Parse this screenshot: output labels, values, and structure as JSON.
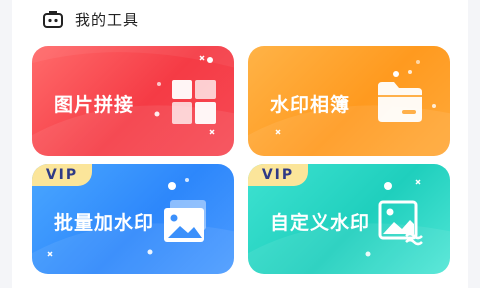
{
  "header": {
    "title": "我的工具",
    "icon": "toolbox-icon"
  },
  "cards": [
    {
      "label": "图片拼接",
      "icon": "grid-collage-icon",
      "vip": false
    },
    {
      "label": "水印相簿",
      "icon": "folder-icon",
      "vip": false
    },
    {
      "label": "批量加水印",
      "icon": "stacked-images-icon",
      "vip": true,
      "badge": "VIP"
    },
    {
      "label": "自定义水印",
      "icon": "image-edit-icon",
      "vip": true,
      "badge": "VIP"
    }
  ],
  "colors": {
    "red": "#f53b45",
    "orange": "#ff9a1f",
    "blue": "#2d87fb",
    "teal": "#1fcfbd",
    "vip_bg": "#fbe59a",
    "vip_text": "#2f3a86"
  }
}
